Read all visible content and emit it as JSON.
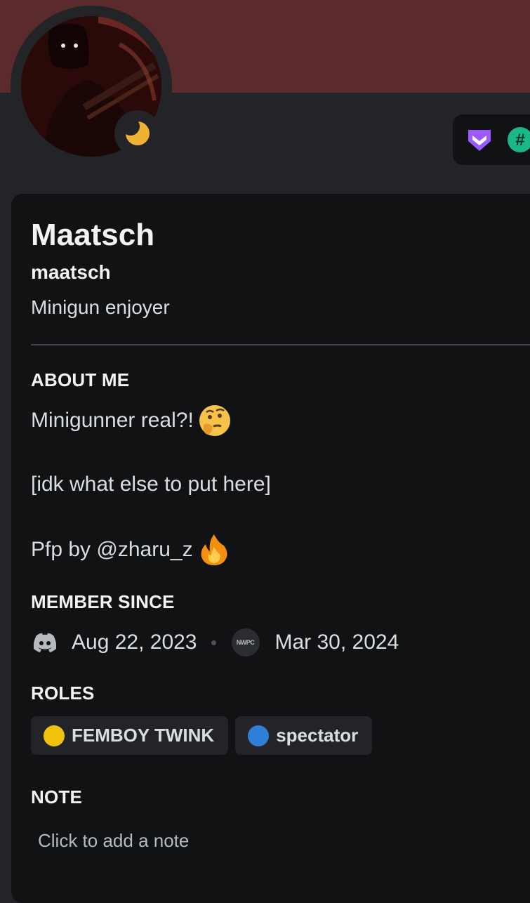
{
  "profile": {
    "display_name": "Maatsch",
    "username": "maatsch",
    "pronouns": "Minigun enjoyer",
    "status": "idle",
    "banner_color": "#5b2a2c"
  },
  "badges": [
    "nitro-badge-icon",
    "hashtag-badge-icon"
  ],
  "about": {
    "title": "ABOUT ME",
    "line1": "Minigunner real?!",
    "line1_emoji": "thinking-face-emoji",
    "line2": "[idk what else to put here]",
    "line3": "Pfp by @zharu_z",
    "line3_emoji": "fire-emoji"
  },
  "member_since": {
    "title": "MEMBER SINCE",
    "discord_date": "Aug 22, 2023",
    "server_abbr": "NWPC",
    "server_date": "Mar 30, 2024"
  },
  "roles": {
    "title": "ROLES",
    "items": [
      {
        "name": "FEMBOY TWINK",
        "color": "#f0c20c"
      },
      {
        "name": "spectator",
        "color": "#2f7ed8"
      }
    ]
  },
  "note": {
    "title": "NOTE",
    "placeholder": "Click to add a note"
  }
}
